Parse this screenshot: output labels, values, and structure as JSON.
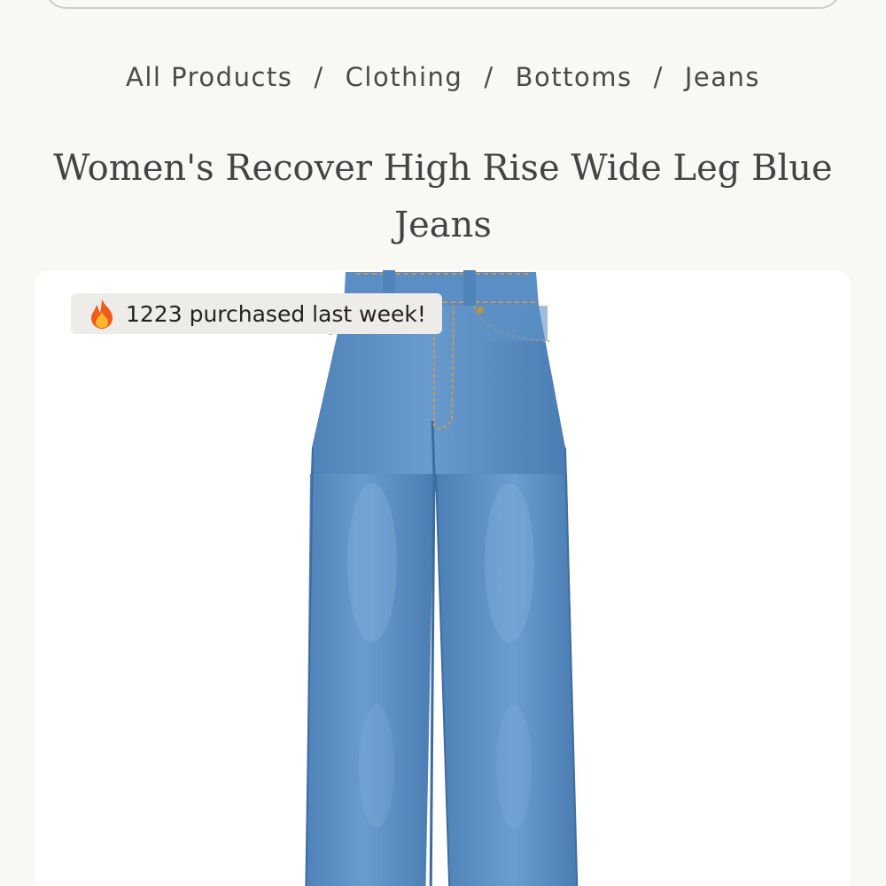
{
  "breadcrumb": {
    "items": [
      "All Products",
      "Clothing",
      "Bottoms",
      "Jeans"
    ],
    "separator": "/"
  },
  "product": {
    "title": "Women's Recover High Rise Wide Leg Blue Jeans"
  },
  "badge": {
    "icon": "fire-icon",
    "text": "1223 purchased last week!"
  },
  "colors": {
    "background": "#f9f8f5",
    "denim": "#5b8fc4",
    "badge_bg": "#eeece8"
  }
}
